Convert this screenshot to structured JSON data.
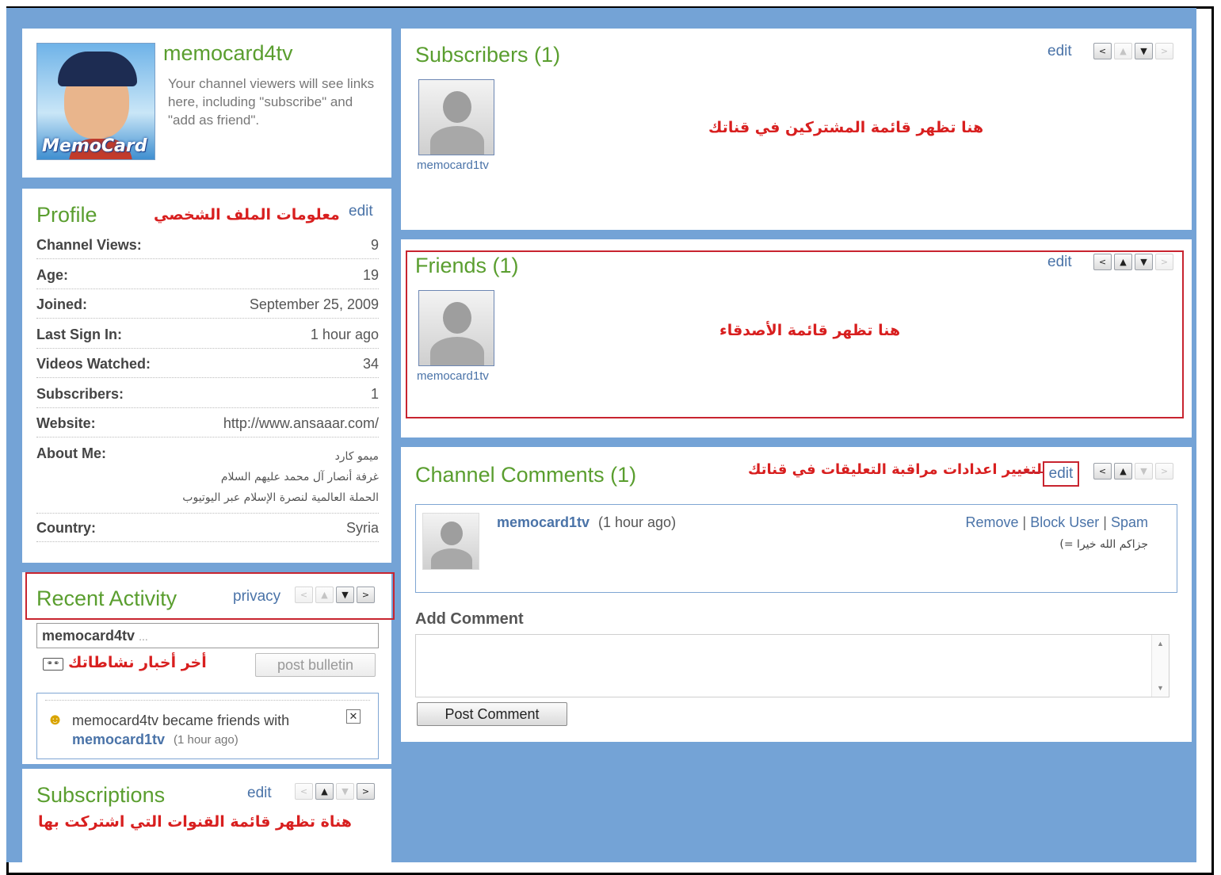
{
  "header": {
    "channel_name": "memocard4tv",
    "description": "Your channel viewers will see links here, including \"subscribe\" and \"add as friend\".",
    "logo_text": "MemoCard"
  },
  "profile": {
    "title": "Profile",
    "annotation": "معلومات الملف الشخصي",
    "edit": "edit",
    "rows": [
      {
        "label": "Channel Views:",
        "value": "9"
      },
      {
        "label": "Age:",
        "value": "19"
      },
      {
        "label": "Joined:",
        "value": "September 25, 2009"
      },
      {
        "label": "Last Sign In:",
        "value": "1 hour ago"
      },
      {
        "label": "Videos Watched:",
        "value": "34"
      },
      {
        "label": "Subscribers:",
        "value": "1"
      },
      {
        "label": "Website:",
        "value": "http://www.ansaaar.com/"
      }
    ],
    "about_label": "About Me:",
    "about_lines": [
      "ميمو كارد",
      "غرفة أنصار آل محمد عليهم السلام",
      "الحملة العالمية لنصرة الإسلام عبر اليوتيوب"
    ],
    "country_label": "Country:",
    "country_value": "Syria"
  },
  "recent_activity": {
    "title": "Recent Activity",
    "privacy": "privacy",
    "input_value": "memocard4tv",
    "input_suffix": "...",
    "annotation": "أخر أخبار نشاطاتك",
    "post_bulletin": "post bulletin",
    "item_text": "memocard4tv became friends with",
    "item_link": "memocard1tv",
    "item_time": "(1 hour ago)"
  },
  "subscriptions": {
    "title": "Subscriptions",
    "edit": "edit",
    "annotation": "هناة تظهر قائمة القنوات التي اشتركت بها"
  },
  "subscribers": {
    "title": "Subscribers (1)",
    "edit": "edit",
    "user": "memocard1tv",
    "annotation": "هنا تظهر قائمة المشتركين في قناتك"
  },
  "friends": {
    "title": "Friends (1)",
    "edit": "edit",
    "user": "memocard1tv",
    "annotation": "هنا تظهر قائمة الأصدقاء"
  },
  "comments": {
    "title": "Channel Comments (1)",
    "edit": "edit",
    "annotation": "لتغيير اعدادات مراقبة التعليقات في قناتك",
    "author": "memocard1tv",
    "time": "(1 hour ago)",
    "remove": "Remove",
    "block_user": "Block User",
    "spam": "Spam",
    "sep": "|",
    "comment_text": "جزاكم الله خيرا =)",
    "add_comment_label": "Add Comment",
    "post_button": "Post Comment"
  },
  "colors": {
    "background": "#74a3d6",
    "title_green": "#5a9e2f",
    "link_blue": "#4a73a8",
    "annotation_red": "#d81f1f"
  }
}
